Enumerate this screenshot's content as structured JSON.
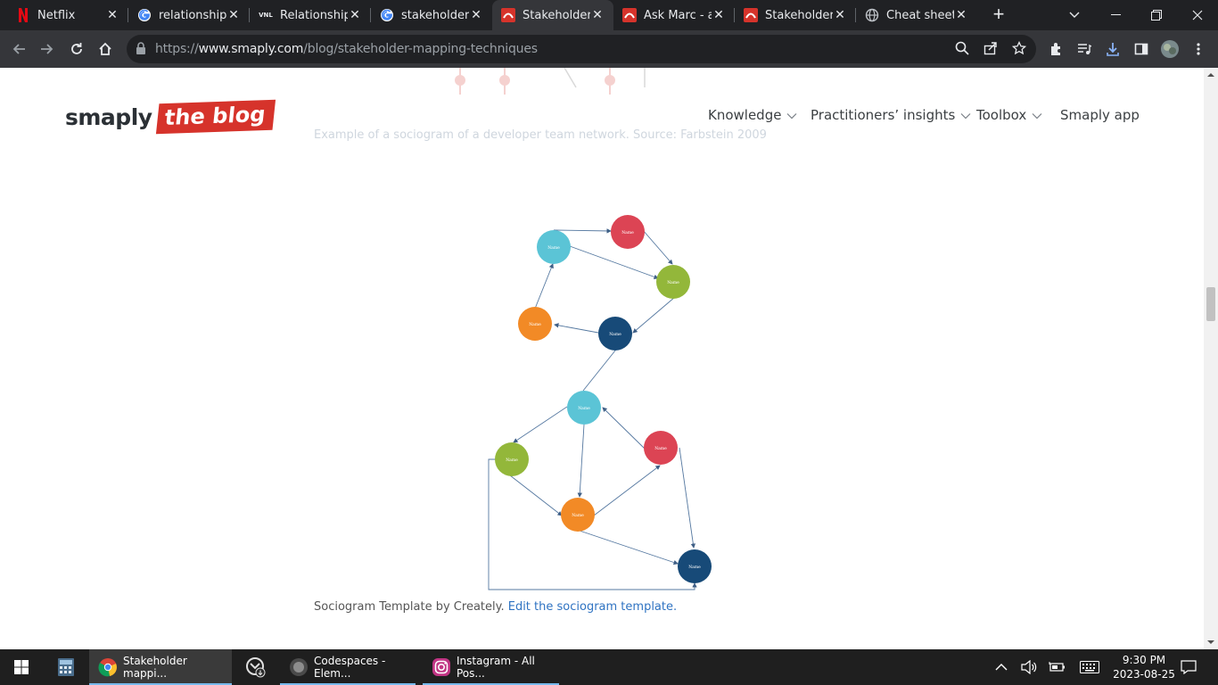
{
  "browser": {
    "tabs": [
      {
        "title": "Netflix",
        "favicon": "netflix-icon",
        "active": false
      },
      {
        "title": "relationship m",
        "favicon": "google-icon",
        "active": false
      },
      {
        "title": "Relationship M",
        "favicon": "vnl-icon",
        "favicon_text": "VNL",
        "active": false
      },
      {
        "title": "stakeholder m",
        "favicon": "google-icon",
        "active": false
      },
      {
        "title": "Stakeholder m",
        "favicon": "smaply-icon",
        "active": true
      },
      {
        "title": "Ask Marc - ab",
        "favicon": "smaply-icon",
        "active": false
      },
      {
        "title": "Stakeholder m",
        "favicon": "smaply-icon",
        "active": false
      },
      {
        "title": "Cheat sheet –",
        "favicon": "globe-icon",
        "active": false
      }
    ],
    "url_prefix": "https://",
    "url_host": "www.smaply.com",
    "url_path": "/blog/stakeholder-mapping-techniques"
  },
  "site": {
    "logo_word": "smaply",
    "logo_tag": "the blog",
    "nav": [
      {
        "label": "Knowledge",
        "has_dropdown": true
      },
      {
        "label": "Practitioners’ insights",
        "has_dropdown": true
      },
      {
        "label": "Toolbox",
        "has_dropdown": true
      },
      {
        "label": "Smaply app",
        "has_dropdown": false
      }
    ],
    "faded_caption": "Example of a sociogram of a developer team network. Source: Farbstein 2009"
  },
  "sociogram": {
    "node_label": "Name",
    "colors": {
      "cyan": "#5bc4d6",
      "red": "#dc4454",
      "green": "#93b73a",
      "orange": "#f28a26",
      "navy": "#174a78"
    },
    "nodes": [
      "cyan",
      "red",
      "green",
      "orange",
      "navy",
      "cyan",
      "red",
      "green",
      "orange",
      "navy"
    ]
  },
  "caption": {
    "text": "Sociogram Template by Creately.",
    "link": "Edit the sociogram template."
  },
  "taskbar": {
    "apps": [
      {
        "label": "Stakeholder mappi...",
        "icon": "chrome-icon",
        "active": true
      },
      {
        "label": "Codespaces - Elem...",
        "icon": "chrome-profile-icon",
        "active": false
      },
      {
        "label": "Instagram - All Pos...",
        "icon": "instagram-icon",
        "active": false
      }
    ],
    "time": "9:30 PM",
    "date": "2023-08-25"
  }
}
